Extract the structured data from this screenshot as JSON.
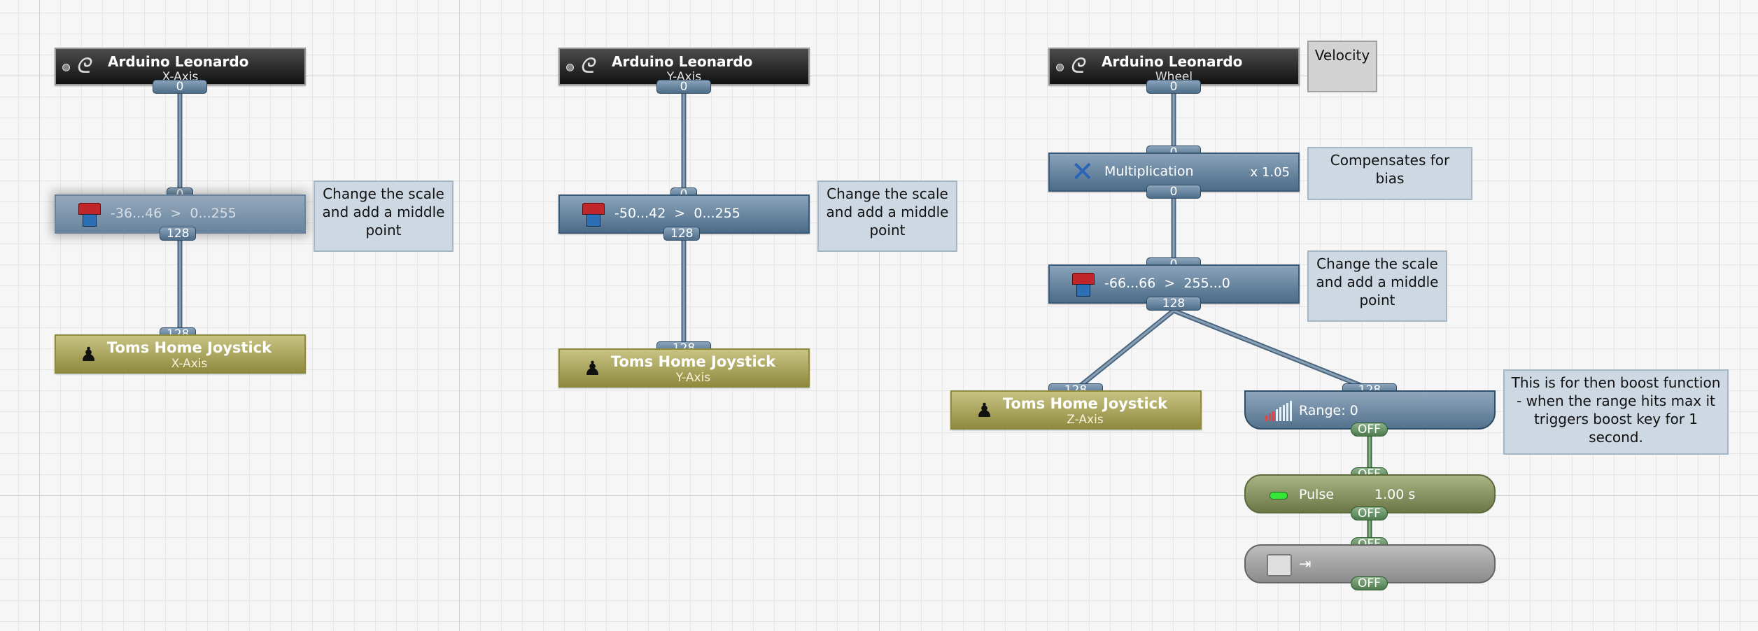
{
  "colors": {
    "link": "#7e95a9",
    "link_dark": "#4a6680"
  },
  "col1": {
    "device": {
      "icon": "arduino-icon",
      "title": "Arduino Leonardo",
      "axis": "X-Axis",
      "out_port": "0"
    },
    "scale": {
      "icon": "scale-icon",
      "in_port": "0",
      "label": "-36...46  >  0...255",
      "out_port": "128"
    },
    "comment": "Change the scale and add a middle point",
    "joystick": {
      "icon": "joystick-icon",
      "in_port": "128",
      "title": "Toms Home Joystick",
      "axis": "X-Axis"
    }
  },
  "col2": {
    "device": {
      "icon": "arduino-icon",
      "title": "Arduino Leonardo",
      "axis": "Y-Axis",
      "out_port": "0"
    },
    "scale": {
      "icon": "scale-icon",
      "in_port": "0",
      "label": "-50...42  >  0...255",
      "out_port": "128"
    },
    "comment": "Change the scale and add a middle point",
    "joystick": {
      "icon": "joystick-icon",
      "in_port": "128",
      "title": "Toms Home Joystick",
      "axis": "Y-Axis"
    }
  },
  "col3": {
    "device": {
      "icon": "arduino-icon",
      "title": "Arduino Leonardo",
      "axis": "Wheel",
      "out_port": "0"
    },
    "velocity_comment": "Velocity",
    "mult": {
      "icon": "multiply-icon",
      "in_port": "0",
      "label": "Multiplication",
      "factor": "x 1.05",
      "out_port": "0"
    },
    "mult_comment": "Compensates for bias",
    "scale": {
      "icon": "scale-icon",
      "in_port": "0",
      "label": "-66...66  >  255...0",
      "out_port": "128"
    },
    "scale_comment": "Change the scale and add a middle point",
    "joystick": {
      "icon": "joystick-icon",
      "in_port": "128",
      "title": "Toms Home Joystick",
      "axis": "Z-Axis"
    },
    "range": {
      "icon": "range-icon",
      "in_port": "128",
      "label": "Range: 0",
      "out_port": "OFF"
    },
    "range_comment": "This is for then boost function - when the range hits max it triggers boost key for 1 second.",
    "pulse": {
      "icon": "led-icon",
      "in_port": "OFF",
      "label": "Pulse",
      "duration": "1.00 s",
      "out_port": "OFF"
    },
    "key": {
      "icon": "keyboard-icon",
      "in_port": "OFF",
      "label": "⇥",
      "out_port": "OFF"
    }
  }
}
